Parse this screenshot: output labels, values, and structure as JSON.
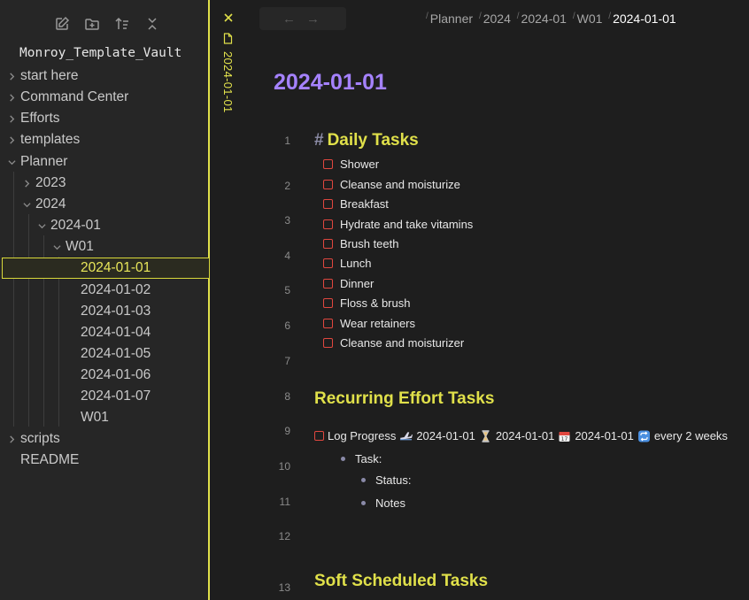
{
  "sidebar": {
    "toolbar": [
      "new-note-icon",
      "new-folder-icon",
      "sort-icon",
      "collapse-all-icon"
    ],
    "vault_name": "Monroy_Template_Vault",
    "items": [
      {
        "label": "start  here"
      },
      {
        "label": "Command Center"
      },
      {
        "label": "Efforts"
      },
      {
        "label": "templates"
      },
      {
        "label": "Planner"
      },
      {
        "label": "2023"
      },
      {
        "label": "2024"
      },
      {
        "label": "2024-01"
      },
      {
        "label": "W01"
      },
      {
        "label": "2024-01-01"
      },
      {
        "label": "2024-01-02"
      },
      {
        "label": "2024-01-03"
      },
      {
        "label": "2024-01-04"
      },
      {
        "label": "2024-01-05"
      },
      {
        "label": "2024-01-06"
      },
      {
        "label": "2024-01-07"
      },
      {
        "label": "W01"
      },
      {
        "label": "scripts"
      },
      {
        "label": "README"
      }
    ]
  },
  "tab": {
    "title": "2024-01-01"
  },
  "nav": {
    "back": "←",
    "forward": "→"
  },
  "breadcrumb": [
    "Planner",
    "2024",
    "2024-01",
    "W01",
    "2024-01-01"
  ],
  "note": {
    "title": "2024-01-01",
    "line_numbers": [
      "1",
      "2",
      "3",
      "4",
      "5",
      "6",
      "7",
      "8",
      "9",
      "10",
      "11",
      "12",
      "13"
    ],
    "daily_heading_hash": "#",
    "daily_heading": "Daily Tasks",
    "daily_tasks": [
      "Shower",
      "Cleanse and moisturize",
      "Breakfast",
      "Hydrate and take vitamins",
      "Brush teeth",
      "Lunch",
      "Dinner",
      "Floss & brush",
      "Wear retainers",
      "Cleanse and moisturizer"
    ],
    "recurring_heading": "Recurring Effort Tasks",
    "recurring_task": {
      "label": "Log Progress",
      "start_date": "2024-01-01",
      "scheduled_date": "2024-01-01",
      "due_date": "2024-01-01",
      "recurrence": "every 2 weeks"
    },
    "sub_bullets": {
      "task": "Task:",
      "status": "Status:",
      "notes": "Notes"
    },
    "soft_heading": "Soft Scheduled Tasks"
  },
  "colors": {
    "accent_yellow": "#e0e04a",
    "title_purple": "#a582ff",
    "checkbox_red": "#e0473f"
  }
}
